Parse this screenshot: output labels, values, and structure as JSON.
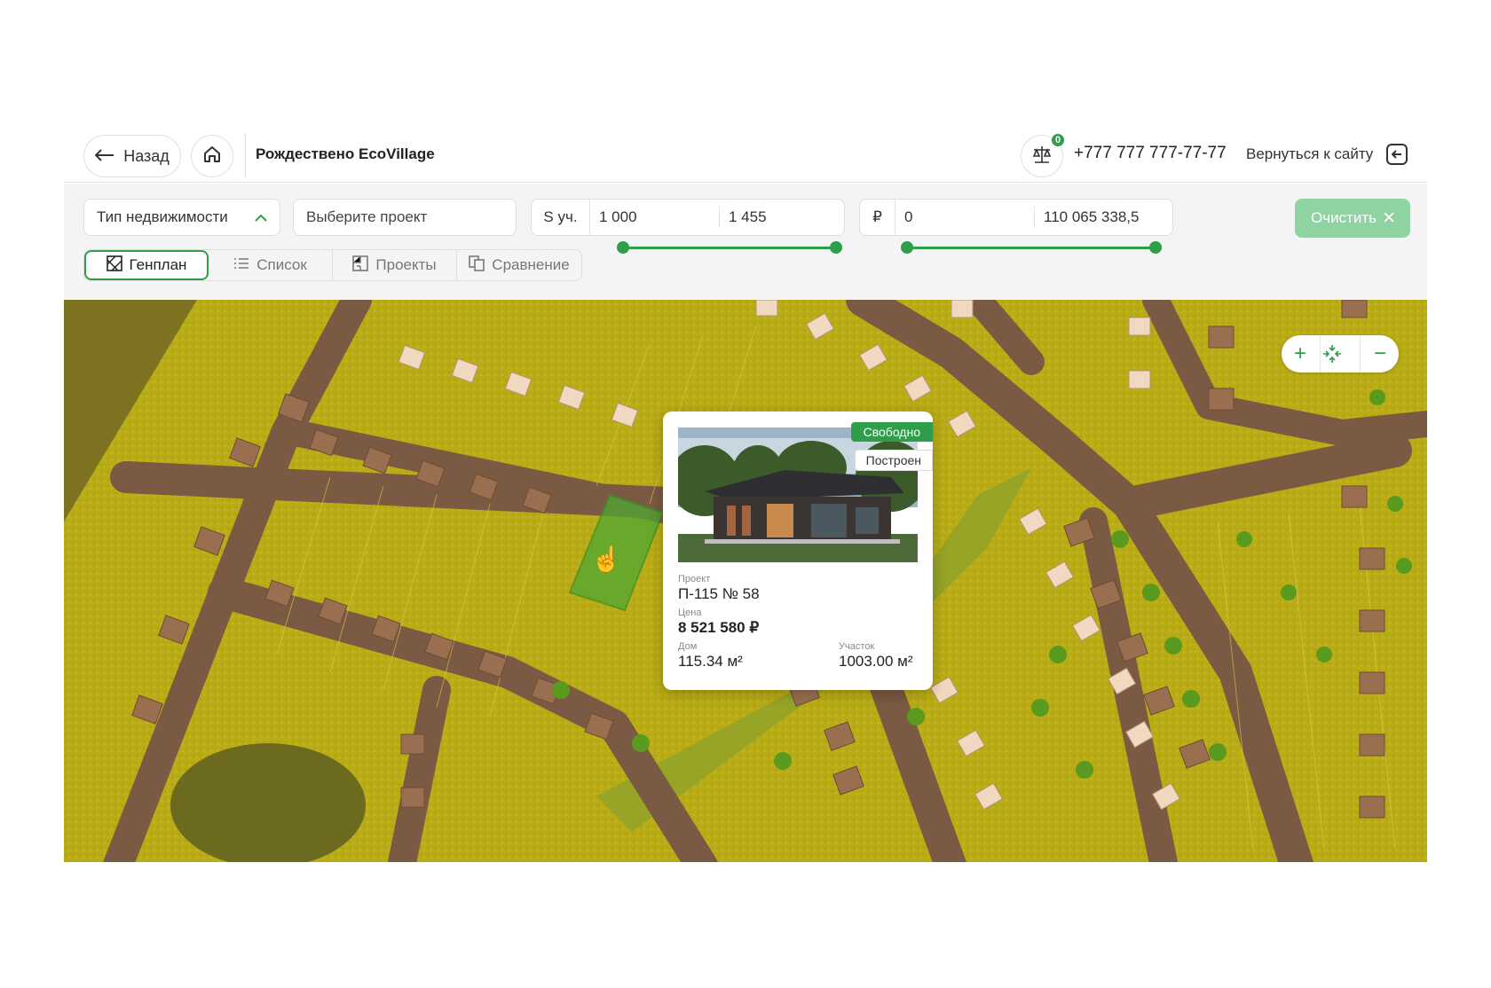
{
  "header": {
    "back_label": "Назад",
    "title": "Рождествено EcoVillage",
    "compare_count": "0",
    "phone": "+777 777 777-77-77",
    "return_label": "Вернуться к сайту"
  },
  "filters": {
    "property_type_label": "Тип недвижимости",
    "project_placeholder": "Выберите проект",
    "area": {
      "label": "S уч.",
      "min": "1 000",
      "max": "1 455"
    },
    "price": {
      "label": "₽",
      "min": "0",
      "max": "110 065 338,5"
    },
    "clear_label": "Очистить"
  },
  "tabs": [
    {
      "label": "Генплан",
      "active": true
    },
    {
      "label": "Список",
      "active": false
    },
    {
      "label": "Проекты",
      "active": false
    },
    {
      "label": "Сравнение",
      "active": false
    }
  ],
  "zoom": {
    "in": "+",
    "out": "−"
  },
  "popup": {
    "status": "Свободно",
    "stage": "Построен",
    "project_label": "Проект",
    "project_value": "П-115 № 58",
    "price_label": "Цена",
    "price_value": "8 521 580 ₽",
    "house_label": "Дом",
    "house_value": "115.34 м²",
    "plot_label": "Участок",
    "plot_value": "1003.00 м²"
  },
  "colors": {
    "accent": "#2e9e4a",
    "clear_button": "#8fd3a3",
    "field": "#b7aa14",
    "road": "#7a5a42"
  }
}
